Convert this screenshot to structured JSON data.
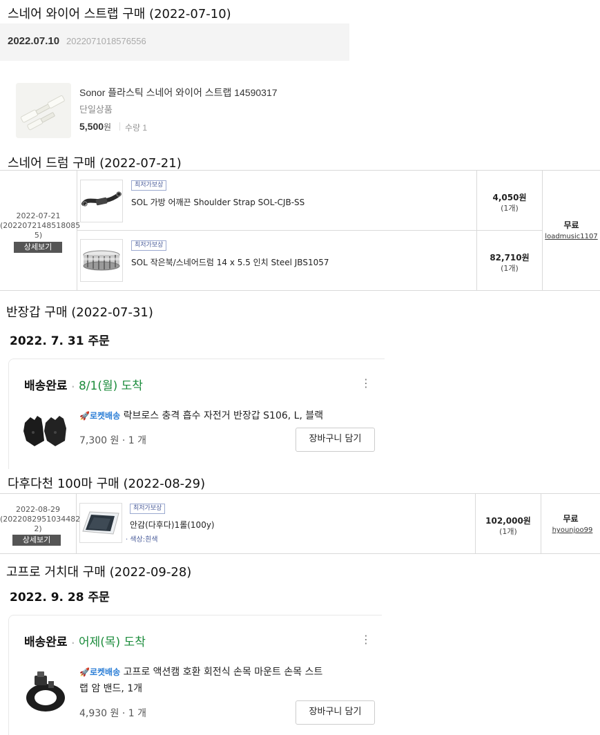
{
  "section1": {
    "heading": "스네어 와이어 스트랩 구매 (2022-07-10)",
    "date": "2022.07.10",
    "order_no": "2022071018576556",
    "product_name": "Sonor 플라스틱 스네어 와이어 스트랩 14590317",
    "product_option": "단일상품",
    "price": "5,500",
    "price_unit": "원",
    "qty": "수량 1"
  },
  "section2": {
    "heading": "스네어 드럼 구매 (2022-07-21)",
    "date": "2022-07-21",
    "order_no": "(2022072148518085",
    "order_no_tail": "5)",
    "detail_button": "상세보기",
    "items": [
      {
        "badge": "최저가보상",
        "name": "SOL 가방 어깨끈 Shoulder Strap SOL-CJB-SS",
        "price": "4,050원",
        "qty": "(1개)"
      },
      {
        "badge": "최저가보상",
        "name": "SOL 작은북/스네어드럼 14 x 5.5 인치 Steel JBS1057",
        "price": "82,710원",
        "qty": "(1개)"
      }
    ],
    "shipping": "무료",
    "seller": "loadmusic1107"
  },
  "section3": {
    "heading": "반장갑 구매 (2022-07-31)",
    "order_date": "2022. 7. 31 주문",
    "status": "배송완료",
    "dot": "·",
    "arrival": "8/1(월) 도착",
    "rocket": "로켓배송",
    "product_name": "락브로스 충격 흡수 자전거 반장갑 S106, L, 블랙",
    "price_qty": "7,300 원 · 1 개",
    "cart_button": "장바구니 담기"
  },
  "section4": {
    "heading": "다후다천 100마 구매 (2022-08-29)",
    "date": "2022-08-29",
    "order_no": "(2022082951034482",
    "order_no_tail": "2)",
    "detail_button": "상세보기",
    "badge": "최저가보상",
    "product_name": "안감(다후다)1롤(100y)",
    "option": "· 색상:흰색",
    "price": "102,000원",
    "qty": "(1개)",
    "shipping": "무료",
    "seller": "hyounjoo99"
  },
  "section5": {
    "heading": "고프로 거치대 구매 (2022-09-28)",
    "order_date": "2022. 9. 28 주문",
    "status": "배송완료",
    "dot": "·",
    "arrival": "어제(목) 도착",
    "rocket": "로켓배송",
    "product_name_line1": "고프로 액션캠 호환 회전식 손목 마운트 손목 스트",
    "product_name_line2": "랩 암 밴드, 1개",
    "price_qty": "4,930 원 · 1 개",
    "cart_button": "장바구니 담기"
  },
  "icons": {
    "kebab": "⋮",
    "rocket": "🚀"
  }
}
